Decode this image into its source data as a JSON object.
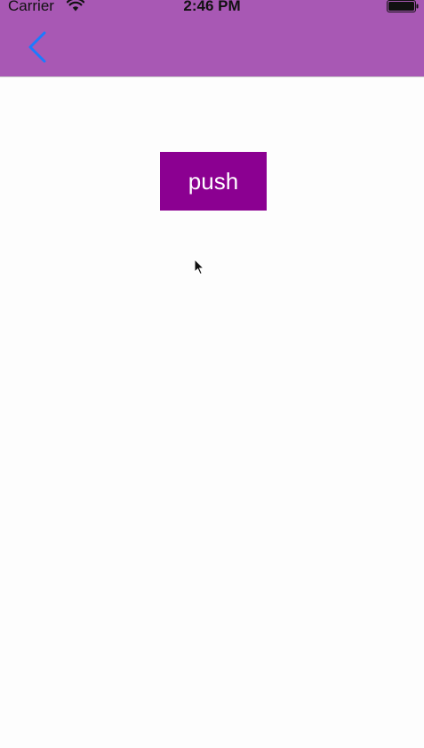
{
  "status_bar": {
    "carrier": "Carrier",
    "time": "2:46 PM",
    "wifi_icon": "wifi-icon",
    "battery_icon": "battery-icon"
  },
  "nav_bar": {
    "background_color": "#a858b4",
    "back_icon": "chevron-left-icon",
    "back_icon_color": "#1a7bff"
  },
  "main": {
    "push_button_label": "push",
    "push_button_color": "#8b0091"
  },
  "cursor_icon": "mouse-pointer-icon"
}
